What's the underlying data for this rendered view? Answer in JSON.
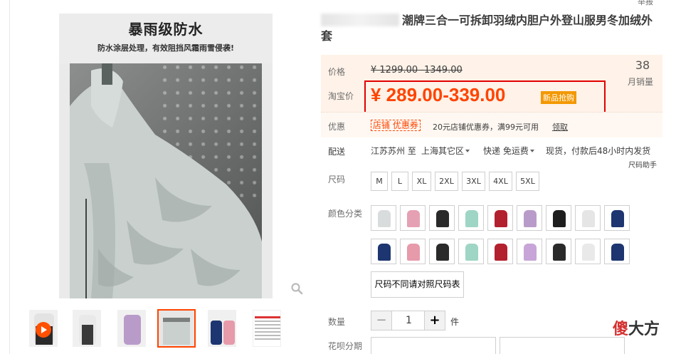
{
  "main_image": {
    "headline": "暴雨级防水",
    "subline": "防水涂层处理，有效阻挡风霜雨雪侵袭!"
  },
  "thumbnails": [
    {
      "name": "video",
      "has_play": true
    },
    {
      "name": "white-coat"
    },
    {
      "name": "purple-coat"
    },
    {
      "name": "detail-active"
    },
    {
      "name": "couple"
    },
    {
      "name": "size-table"
    }
  ],
  "product": {
    "title_visible": "潮牌三合一可拆卸羽绒内胆户外登山服男冬加绒外套",
    "report": "举报"
  },
  "price": {
    "label": "价格",
    "original": "¥ 1299.00 -1349.00",
    "tb_label": "淘宝价",
    "current": "¥ 289.00-339.00",
    "badge": "新品抢购",
    "sales_count": "38",
    "sales_label": "月销量"
  },
  "promo": {
    "label": "优惠",
    "tag": "店铺  优惠券",
    "text": "20元店铺优惠券，满99元可用",
    "link": "领取"
  },
  "shipping": {
    "label": "配送",
    "from": "江苏苏州 至",
    "to": "上海其它区",
    "method": "快递 免运费",
    "stock": "现货，付款后48小时内发货",
    "size_helper": "尺码助手"
  },
  "sizes": {
    "label": "尺码",
    "options": [
      "M",
      "L",
      "XL",
      "2XL",
      "3XL",
      "4XL",
      "5XL"
    ]
  },
  "colors": {
    "label": "颜色分类",
    "swatches": [
      "#d9dcdc",
      "#e6a0b4",
      "#2a2a2a",
      "#9fd5c4",
      "#b3202e",
      "#b99bc9",
      "#1e1e1e",
      "#e5e5e5",
      "#1d3570",
      "#1d3570",
      "#e69aaa",
      "#2a2a2a",
      "#9fd5c4",
      "#b3202e",
      "#c7a5d8",
      "#2a2a2a",
      "#e9e9e9",
      "#1d3570"
    ]
  },
  "size_chart_button": "尺码不同请对照尺码表",
  "quantity": {
    "label": "数量",
    "value": "1",
    "unit": "件"
  },
  "installment": {
    "label": "花呗分期"
  },
  "watermark": {
    "red": "傻",
    "black": "大方"
  },
  "colors_theme": {
    "accent": "#ff4400",
    "price_bg": "#fff2e8",
    "highlight_box": "#e00000"
  }
}
